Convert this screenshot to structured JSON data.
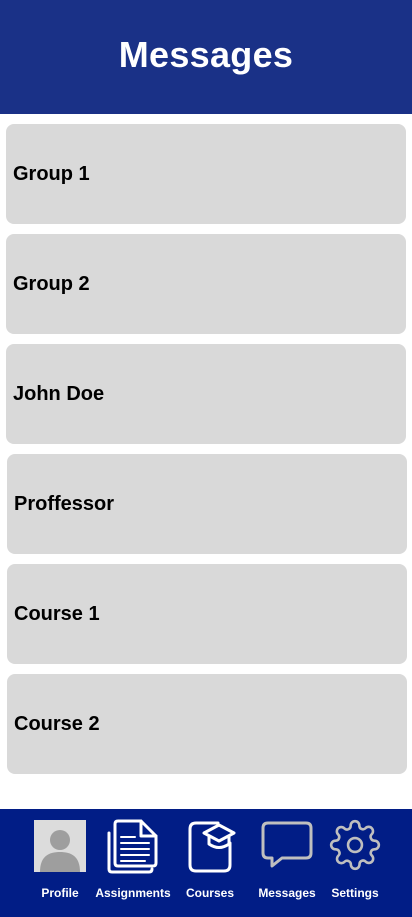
{
  "header": {
    "title": "Messages"
  },
  "conversations": [
    {
      "label": "Group 1"
    },
    {
      "label": "Group 2"
    },
    {
      "label": "John Doe"
    },
    {
      "label": "Proffessor"
    },
    {
      "label": "Course 1"
    },
    {
      "label": "Course 2"
    }
  ],
  "nav": {
    "items": [
      {
        "label": "Profile",
        "icon": "profile-avatar-icon"
      },
      {
        "label": "Assignments",
        "icon": "document-icon"
      },
      {
        "label": "Courses",
        "icon": "graduation-cap-icon"
      },
      {
        "label": "Messages",
        "icon": "chat-bubble-icon"
      },
      {
        "label": "Settings",
        "icon": "gear-icon"
      }
    ]
  },
  "colors": {
    "header_bg": "#1a3187",
    "nav_bg": "#011d86",
    "card_bg": "#d9d9d9",
    "active_icon": "#bfbfbf"
  }
}
